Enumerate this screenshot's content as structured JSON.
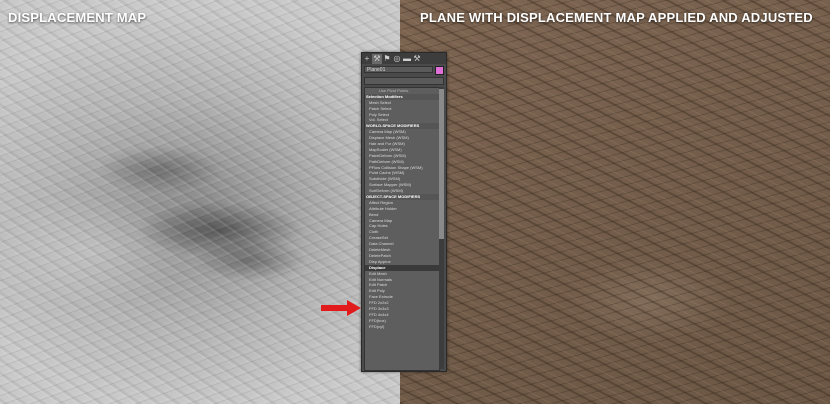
{
  "captions": {
    "left": "DISPLACEMENT MAP",
    "right": "PLANE WITH DISPLACEMENT MAP APPLIED AND ADJUSTED"
  },
  "command_panel": {
    "toolbar_icons": [
      "create-icon",
      "modify-icon",
      "hierarchy-icon",
      "motion-icon",
      "display-icon",
      "utilities-icon"
    ],
    "object_name": "Plane01",
    "name_color": "#e070d8",
    "modifier_list": [
      {
        "label": "Use Pivot Points",
        "type": "pin"
      },
      {
        "label": "Selection Modifiers",
        "type": "header"
      },
      {
        "label": "Mesh Select",
        "type": "item"
      },
      {
        "label": "Patch Select",
        "type": "item"
      },
      {
        "label": "Poly Select",
        "type": "item"
      },
      {
        "label": "Vol. Select",
        "type": "item"
      },
      {
        "label": "WORLD-SPACE MODIFIERS",
        "type": "header"
      },
      {
        "label": "Camera Map (WSM)",
        "type": "item"
      },
      {
        "label": "Displace Mesh (WSM)",
        "type": "item"
      },
      {
        "label": "Hair and Fur (WSM)",
        "type": "item"
      },
      {
        "label": "MapScaler (WSM)",
        "type": "item"
      },
      {
        "label": "PatchDeform (WSM)",
        "type": "item"
      },
      {
        "label": "PathDeform (WSM)",
        "type": "item"
      },
      {
        "label": "PFlow Collision Shape (WSM)",
        "type": "item"
      },
      {
        "label": "Point Cache (WSM)",
        "type": "item"
      },
      {
        "label": "Subdivide (WSM)",
        "type": "item"
      },
      {
        "label": "Surface Mapper (WSM)",
        "type": "item"
      },
      {
        "label": "SurfDeform (WSM)",
        "type": "item"
      },
      {
        "label": "OBJECT-SPACE MODIFIERS",
        "type": "header"
      },
      {
        "label": "Affect Region",
        "type": "item"
      },
      {
        "label": "Attribute Holder",
        "type": "item"
      },
      {
        "label": "Bend",
        "type": "item"
      },
      {
        "label": "Camera Map",
        "type": "item"
      },
      {
        "label": "Cap Holes",
        "type": "item"
      },
      {
        "label": "Cloth",
        "type": "item"
      },
      {
        "label": "CreaseSet",
        "type": "item"
      },
      {
        "label": "Data Channel",
        "type": "item"
      },
      {
        "label": "DeleteMesh",
        "type": "item"
      },
      {
        "label": "DeletePatch",
        "type": "item"
      },
      {
        "label": "Disp Approx",
        "type": "item"
      },
      {
        "label": "Displace",
        "type": "selected"
      },
      {
        "label": "Edit Mesh",
        "type": "item"
      },
      {
        "label": "Edit Normals",
        "type": "item"
      },
      {
        "label": "Edit Patch",
        "type": "item"
      },
      {
        "label": "Edit Poly",
        "type": "item"
      },
      {
        "label": "Face Extrude",
        "type": "item"
      },
      {
        "label": "FFD 2x2x2",
        "type": "item"
      },
      {
        "label": "FFD 3x3x3",
        "type": "item"
      },
      {
        "label": "FFD 4x4x4",
        "type": "item"
      },
      {
        "label": "FFD(box)",
        "type": "item"
      },
      {
        "label": "FFD(cyl)",
        "type": "item"
      }
    ]
  },
  "colors": {
    "displacement_map": "#b5b5b5",
    "plane": "#755f4c",
    "arrow": "#e11b1b"
  }
}
